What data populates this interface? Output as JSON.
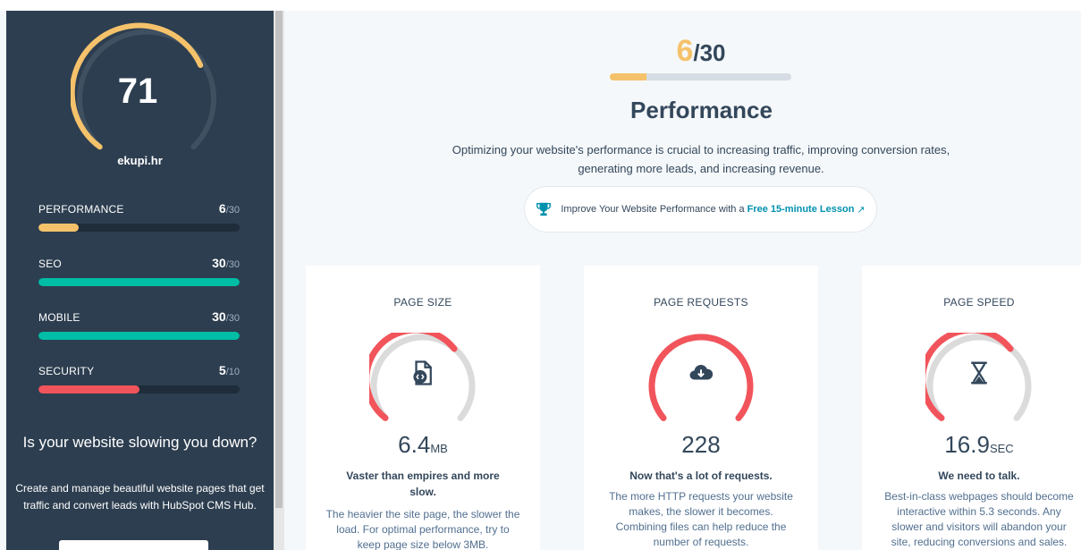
{
  "overall": {
    "score": "71",
    "site": "ekupi.hr"
  },
  "categories": [
    {
      "label": "PERFORMANCE",
      "score": "6",
      "max": "/30",
      "fraction": 0.2,
      "color": "#f5c26b"
    },
    {
      "label": "SEO",
      "score": "30",
      "max": "/30",
      "fraction": 1.0,
      "color": "#00bda5"
    },
    {
      "label": "MOBILE",
      "score": "30",
      "max": "/30",
      "fraction": 1.0,
      "color": "#00bda5"
    },
    {
      "label": "SECURITY",
      "score": "5",
      "max": "/10",
      "fraction": 0.5,
      "color": "#f2545b"
    }
  ],
  "promo": {
    "title": "Is your website slowing you down?",
    "text": "Create and manage beautiful website pages that get traffic and convert leads with HubSpot CMS Hub."
  },
  "section": {
    "score": "6",
    "max": "/30",
    "fraction": 0.2,
    "title": "Performance",
    "description": "Optimizing your website's performance is crucial to increasing traffic, improving conversion rates, generating more leads, and increasing revenue.",
    "lesson_text": "Improve Your Website Performance with a",
    "lesson_link": "Free 15-minute Lesson"
  },
  "cards": [
    {
      "title": "PAGE SIZE",
      "value": "6.4",
      "unit": "MB",
      "icon": "code-file-icon",
      "verdict": "Vaster than empires and more slow.",
      "text": "The heavier the site page, the slower the load. For optimal performance, try to keep page size below 3MB."
    },
    {
      "title": "PAGE REQUESTS",
      "value": "228",
      "unit": "",
      "icon": "cloud-download-icon",
      "verdict": "Now that's a lot of requests.",
      "text": "The more HTTP requests your website makes, the slower it becomes. Combining files can help reduce the number of requests."
    },
    {
      "title": "PAGE SPEED",
      "value": "16.9",
      "unit": "SEC",
      "icon": "hourglass-icon",
      "verdict": "We need to talk.",
      "text": "Best-in-class webpages should become interactive within 5.3 seconds. Any slower and visitors will abandon your site, reducing conversions and sales."
    }
  ],
  "colors": {
    "sidebar": "#2d3e50",
    "warning": "#f5c26b",
    "good": "#00bda5",
    "bad": "#f2545b",
    "link": "#0091ae"
  }
}
